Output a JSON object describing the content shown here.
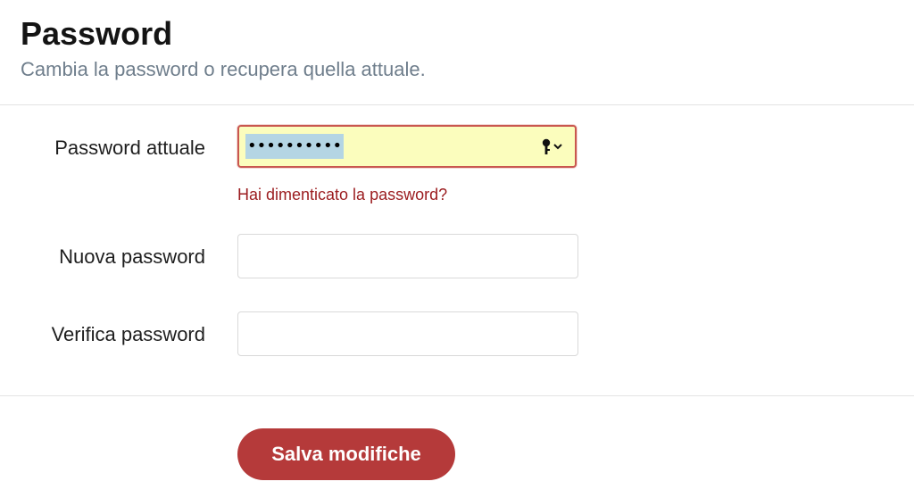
{
  "header": {
    "title": "Password",
    "subtitle": "Cambia la password o recupera quella attuale."
  },
  "form": {
    "current_password": {
      "label": "Password attuale",
      "value": "••••••••••",
      "icon": "key-icon"
    },
    "forgot_link": "Hai dimenticato la password?",
    "new_password": {
      "label": "Nuova password",
      "value": ""
    },
    "verify_password": {
      "label": "Verifica password",
      "value": ""
    }
  },
  "footer": {
    "save_label": "Salva modifiche"
  },
  "colors": {
    "accent": "#b53a3a",
    "link": "#9b1c1f",
    "autofill_bg": "#fbfdbd",
    "subtitle": "#6f7e8c"
  }
}
